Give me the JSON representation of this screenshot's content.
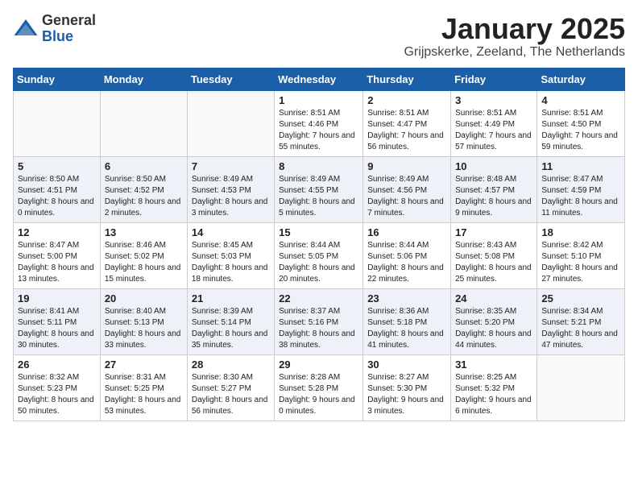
{
  "logo": {
    "general": "General",
    "blue": "Blue"
  },
  "title": "January 2025",
  "location": "Grijpskerke, Zeeland, The Netherlands",
  "days_of_week": [
    "Sunday",
    "Monday",
    "Tuesday",
    "Wednesday",
    "Thursday",
    "Friday",
    "Saturday"
  ],
  "weeks": [
    [
      {
        "day": "",
        "info": ""
      },
      {
        "day": "",
        "info": ""
      },
      {
        "day": "",
        "info": ""
      },
      {
        "day": "1",
        "info": "Sunrise: 8:51 AM\nSunset: 4:46 PM\nDaylight: 7 hours and 55 minutes."
      },
      {
        "day": "2",
        "info": "Sunrise: 8:51 AM\nSunset: 4:47 PM\nDaylight: 7 hours and 56 minutes."
      },
      {
        "day": "3",
        "info": "Sunrise: 8:51 AM\nSunset: 4:49 PM\nDaylight: 7 hours and 57 minutes."
      },
      {
        "day": "4",
        "info": "Sunrise: 8:51 AM\nSunset: 4:50 PM\nDaylight: 7 hours and 59 minutes."
      }
    ],
    [
      {
        "day": "5",
        "info": "Sunrise: 8:50 AM\nSunset: 4:51 PM\nDaylight: 8 hours and 0 minutes."
      },
      {
        "day": "6",
        "info": "Sunrise: 8:50 AM\nSunset: 4:52 PM\nDaylight: 8 hours and 2 minutes."
      },
      {
        "day": "7",
        "info": "Sunrise: 8:49 AM\nSunset: 4:53 PM\nDaylight: 8 hours and 3 minutes."
      },
      {
        "day": "8",
        "info": "Sunrise: 8:49 AM\nSunset: 4:55 PM\nDaylight: 8 hours and 5 minutes."
      },
      {
        "day": "9",
        "info": "Sunrise: 8:49 AM\nSunset: 4:56 PM\nDaylight: 8 hours and 7 minutes."
      },
      {
        "day": "10",
        "info": "Sunrise: 8:48 AM\nSunset: 4:57 PM\nDaylight: 8 hours and 9 minutes."
      },
      {
        "day": "11",
        "info": "Sunrise: 8:47 AM\nSunset: 4:59 PM\nDaylight: 8 hours and 11 minutes."
      }
    ],
    [
      {
        "day": "12",
        "info": "Sunrise: 8:47 AM\nSunset: 5:00 PM\nDaylight: 8 hours and 13 minutes."
      },
      {
        "day": "13",
        "info": "Sunrise: 8:46 AM\nSunset: 5:02 PM\nDaylight: 8 hours and 15 minutes."
      },
      {
        "day": "14",
        "info": "Sunrise: 8:45 AM\nSunset: 5:03 PM\nDaylight: 8 hours and 18 minutes."
      },
      {
        "day": "15",
        "info": "Sunrise: 8:44 AM\nSunset: 5:05 PM\nDaylight: 8 hours and 20 minutes."
      },
      {
        "day": "16",
        "info": "Sunrise: 8:44 AM\nSunset: 5:06 PM\nDaylight: 8 hours and 22 minutes."
      },
      {
        "day": "17",
        "info": "Sunrise: 8:43 AM\nSunset: 5:08 PM\nDaylight: 8 hours and 25 minutes."
      },
      {
        "day": "18",
        "info": "Sunrise: 8:42 AM\nSunset: 5:10 PM\nDaylight: 8 hours and 27 minutes."
      }
    ],
    [
      {
        "day": "19",
        "info": "Sunrise: 8:41 AM\nSunset: 5:11 PM\nDaylight: 8 hours and 30 minutes."
      },
      {
        "day": "20",
        "info": "Sunrise: 8:40 AM\nSunset: 5:13 PM\nDaylight: 8 hours and 33 minutes."
      },
      {
        "day": "21",
        "info": "Sunrise: 8:39 AM\nSunset: 5:14 PM\nDaylight: 8 hours and 35 minutes."
      },
      {
        "day": "22",
        "info": "Sunrise: 8:37 AM\nSunset: 5:16 PM\nDaylight: 8 hours and 38 minutes."
      },
      {
        "day": "23",
        "info": "Sunrise: 8:36 AM\nSunset: 5:18 PM\nDaylight: 8 hours and 41 minutes."
      },
      {
        "day": "24",
        "info": "Sunrise: 8:35 AM\nSunset: 5:20 PM\nDaylight: 8 hours and 44 minutes."
      },
      {
        "day": "25",
        "info": "Sunrise: 8:34 AM\nSunset: 5:21 PM\nDaylight: 8 hours and 47 minutes."
      }
    ],
    [
      {
        "day": "26",
        "info": "Sunrise: 8:32 AM\nSunset: 5:23 PM\nDaylight: 8 hours and 50 minutes."
      },
      {
        "day": "27",
        "info": "Sunrise: 8:31 AM\nSunset: 5:25 PM\nDaylight: 8 hours and 53 minutes."
      },
      {
        "day": "28",
        "info": "Sunrise: 8:30 AM\nSunset: 5:27 PM\nDaylight: 8 hours and 56 minutes."
      },
      {
        "day": "29",
        "info": "Sunrise: 8:28 AM\nSunset: 5:28 PM\nDaylight: 9 hours and 0 minutes."
      },
      {
        "day": "30",
        "info": "Sunrise: 8:27 AM\nSunset: 5:30 PM\nDaylight: 9 hours and 3 minutes."
      },
      {
        "day": "31",
        "info": "Sunrise: 8:25 AM\nSunset: 5:32 PM\nDaylight: 9 hours and 6 minutes."
      },
      {
        "day": "",
        "info": ""
      }
    ]
  ]
}
